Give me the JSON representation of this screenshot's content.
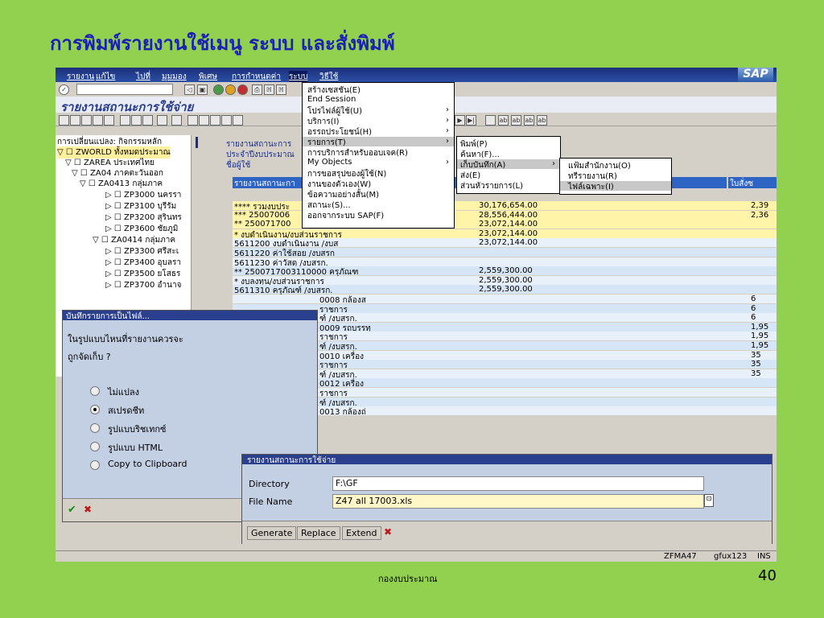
{
  "slide": {
    "title": "การพิมพ์รายงานใช้เมนู ระบบ และสั่งพิมพ์",
    "footer": "กองงบประมาณ",
    "page_number": "40"
  },
  "sap": {
    "logo": "SAP",
    "menubar": [
      "รายงาน",
      "แก้ไข",
      "ไปที่",
      "มุมมอง",
      "พิเศษ",
      "การกำหนดค่า",
      "ระบบ",
      "วิธีใช้"
    ],
    "window_title": "รายงานสถานะการใช้จ่าย",
    "tree": {
      "header": "การเปลี่ยนแปลง: กิจกรรมหลัก",
      "items": [
        "▽ ☐ ZWORLD ทั้งหมดประมาณ",
        "▽ ☐ ZAREA ประเทศไทย",
        "▽ ☐ ZA04 ภาคตะวันออก",
        "▽ ☐ ZA0413 กลุ่มภาค",
        "▷ ☐ ZP3000 นครรา",
        "▷ ☐ ZP3100 บุรีรัม",
        "▷ ☐ ZP3200 สุรินทร",
        "▷ ☐ ZP3600 ชัยภูมิ",
        "▽ ☐ ZA0414 กลุ่มภาค",
        "▷ ☐ ZP3300 ศรีสะเ",
        "▷ ☐ ZP3400 อุบลรา",
        "▷ ☐ ZP3500 ยโสธร",
        "▷ ☐ ZP3700 อำนาจ"
      ]
    },
    "report_header": [
      "รายงานสถานะการ",
      "ประจำปีงบประมาณ",
      "ชื่อผู้ใช้"
    ],
    "col_headers": [
      "รายงานสถานะกา",
      "ใบสั่งซ"
    ],
    "rows": [
      {
        "label": "**** รวมงบประ",
        "amount1": "30,176,654.00",
        "amount2": "2,39"
      },
      {
        "label": "***  25007006",
        "amount1": "28,556,444.00",
        "amount2": "2,36"
      },
      {
        "label": "**   250071700",
        "amount1": "23,072,144.00",
        "amount2": ""
      },
      {
        "label": "*    งบดำเนินงาน/งบส่วนราชการ",
        "amount1": "23,072,144.00",
        "amount2": ""
      },
      {
        "label": "5611200  งบดำเนินงาน /งบส",
        "amount1": "23,072,144.00",
        "amount2": ""
      },
      {
        "label": "5611220  ค่าใช้สอย /งบสรก",
        "amount1": "",
        "amount2": ""
      },
      {
        "label": "5611230  ค่าวัสดุ /งบสรก.",
        "amount1": "",
        "amount2": ""
      },
      {
        "label": "**   2500717003110000  ครุภัณฑ",
        "amount1": "2,559,300.00",
        "amount2": ""
      },
      {
        "label": "*    งบลงทุน/งบส่วนราชการ",
        "amount1": "2,559,300.00",
        "amount2": ""
      },
      {
        "label": "5611310  ครุภัณฑ์ /งบสรก.",
        "amount1": "2,559,300.00",
        "amount2": ""
      },
      {
        "label": "0008  กล้องส",
        "amount1": "",
        "amount2": "6"
      },
      {
        "label": "ราชการ",
        "amount1": "",
        "amount2": "6"
      },
      {
        "label": "ฑ์ /งบสรก.",
        "amount1": "",
        "amount2": "6"
      },
      {
        "label": "0009  รถบรรทุ",
        "amount1": "",
        "amount2": "1,95"
      },
      {
        "label": "ราชการ",
        "amount1": "",
        "amount2": "1,95"
      },
      {
        "label": "ฑ์ /งบสรก.",
        "amount1": "",
        "amount2": "1,95"
      },
      {
        "label": "0010  เครื่อง",
        "amount1": "",
        "amount2": "35"
      },
      {
        "label": "ราชการ",
        "amount1": "",
        "amount2": "35"
      },
      {
        "label": "ฑ์ /งบสรก.",
        "amount1": "",
        "amount2": "35"
      },
      {
        "label": "0012  เครื่อง",
        "amount1": "",
        "amount2": ""
      },
      {
        "label": "ราชการ",
        "amount1": "",
        "amount2": ""
      },
      {
        "label": "ฑ์ /งบสรก.",
        "amount1": "",
        "amount2": ""
      },
      {
        "label": "0013  กล้องถ่",
        "amount1": "",
        "amount2": ""
      }
    ],
    "system_menu": [
      "สร้างเซสชัน(E)",
      "End Session",
      "โปรไฟล์ผู้ใช้(U)",
      "บริการ(I)",
      "อรรถประโยชน์(H)",
      "รายการ(T)",
      "การบริการสำหรับออบเจค(R)",
      "My Objects",
      "การขอสรุปของผู้ใช้(N)",
      "งานของตัวเอง(W)",
      "ข้อความอย่างสั้น(M)",
      "สถานะ(S)...",
      "ออกจากระบบ SAP(F)"
    ],
    "list_menu": [
      "พิมพ์(P)",
      "ค้นหา(F)...",
      "เก็บบันทึก(A)",
      "ส่ง(E)",
      "ส่วนหัวรายการ(L)"
    ],
    "save_menu": [
      "แฟ้มสำนักงาน(O)",
      "ทรีรายงาน(R)",
      "ไฟล์เฉพาะ(I)"
    ],
    "dialog1": {
      "title": "บันทึกรายการเป็นไฟล์...",
      "question_line1": "ในรูปแบบไหนที่รายงานควรจะ",
      "question_line2": "ถูกจัดเก็บ ?",
      "options": [
        "ไม่แปลง",
        "สเปรดชีท",
        "รูปแบบริชเทกซ์",
        "รูปแบบ HTML",
        "Copy to Clipboard"
      ],
      "selected_index": 1,
      "ok_icon": "check-icon",
      "cancel_icon": "cancel-icon"
    },
    "dialog2": {
      "title": "รายงานสถานะการใช้จ่าย",
      "directory_label": "Directory",
      "directory_value": "F:\\GF",
      "filename_label": "File Name",
      "filename_value": "Z47 all 17003.xls",
      "buttons": [
        "Generate",
        "Replace",
        "Extend"
      ]
    },
    "status": {
      "transaction": "ZFMA47",
      "server": "gfux123",
      "mode": "INS"
    }
  }
}
